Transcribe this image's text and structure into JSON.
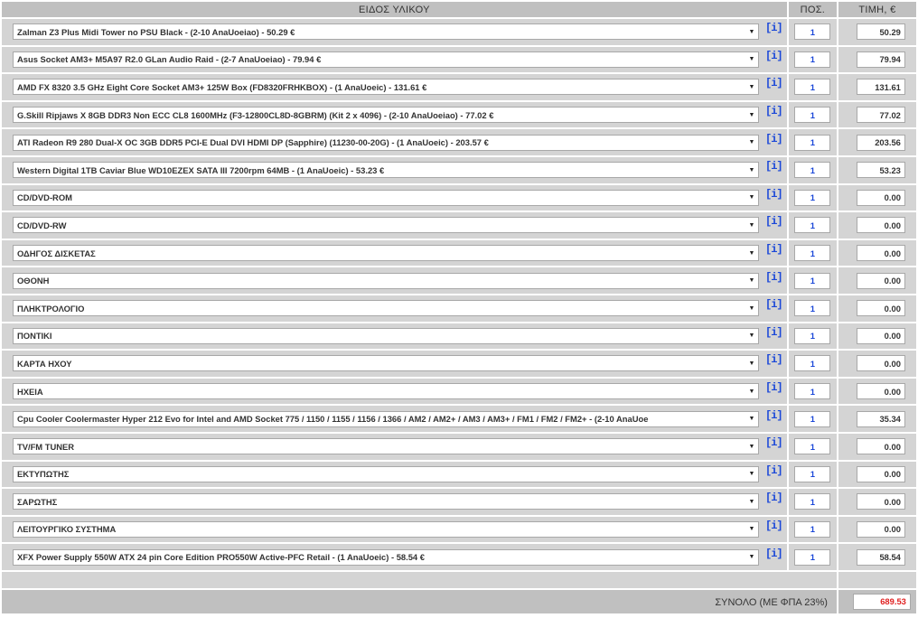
{
  "header": {
    "item_col": "ΕΙΔΟΣ ΥΛΙΚΟΥ",
    "qty_col": "ΠΟΣ.",
    "price_col": "ΤΙΜΗ, €"
  },
  "info_icon": "[i]",
  "dropdown_arrow": "▼",
  "rows": [
    {
      "item": "Zalman Z3 Plus Midi Tower no PSU Black - (2-10 AnaUoeiao) - 50.29 €",
      "qty": "1",
      "price": "50.29"
    },
    {
      "item": "Asus Socket AM3+ M5A97 R2.0 GLan Audio Raid - (2-7 AnaUoeiao) - 79.94 €",
      "qty": "1",
      "price": "79.94"
    },
    {
      "item": "AMD FX 8320 3.5 GHz Eight Core Socket AM3+ 125W Box (FD8320FRHKBOX) - (1 AnaUoeic) - 131.61 €",
      "qty": "1",
      "price": "131.61"
    },
    {
      "item": "G.Skill Ripjaws X 8GB DDR3 Non ECC CL8 1600MHz (F3-12800CL8D-8GBRM) (Kit 2 x 4096) - (2-10 AnaUoeiao) - 77.02 €",
      "qty": "1",
      "price": "77.02"
    },
    {
      "item": "ATI Radeon R9 280 Dual-X OC 3GB DDR5 PCI-E Dual DVI HDMI DP (Sapphire) (11230-00-20G) - (1 AnaUoeic) - 203.57 €",
      "qty": "1",
      "price": "203.56"
    },
    {
      "item": "Western Digital 1TB Caviar Blue WD10EZEX SATA III 7200rpm 64MB - (1 AnaUoeic) - 53.23 €",
      "qty": "1",
      "price": "53.23"
    },
    {
      "item": "CD/DVD-ROM",
      "qty": "1",
      "price": "0.00"
    },
    {
      "item": "CD/DVD-RW",
      "qty": "1",
      "price": "0.00"
    },
    {
      "item": "ΟΔΗΓΟΣ ΔΙΣΚΕΤΑΣ",
      "qty": "1",
      "price": "0.00"
    },
    {
      "item": "ΟΘΟΝΗ",
      "qty": "1",
      "price": "0.00"
    },
    {
      "item": "ΠΛΗΚΤΡΟΛΟΓΙΟ",
      "qty": "1",
      "price": "0.00"
    },
    {
      "item": "ΠΟΝΤΙΚΙ",
      "qty": "1",
      "price": "0.00"
    },
    {
      "item": "ΚΑΡΤΑ ΗΧΟΥ",
      "qty": "1",
      "price": "0.00"
    },
    {
      "item": "ΗΧΕΙΑ",
      "qty": "1",
      "price": "0.00"
    },
    {
      "item": "Cpu Cooler Coolermaster Hyper 212 Evo for Intel and AMD Socket 775 / 1150 / 1155 / 1156 / 1366 / AM2 / AM2+ / AM3 / AM3+ / FM1 / FM2 / FM2+ - (2-10 AnaUoe",
      "qty": "1",
      "price": "35.34"
    },
    {
      "item": "TV/FM TUNER",
      "qty": "1",
      "price": "0.00"
    },
    {
      "item": "ΕΚΤΥΠΩΤΗΣ",
      "qty": "1",
      "price": "0.00"
    },
    {
      "item": "ΣΑΡΩΤΗΣ",
      "qty": "1",
      "price": "0.00"
    },
    {
      "item": "ΛΕΙΤΟΥΡΓΙΚΟ ΣΥΣΤΗΜΑ",
      "qty": "1",
      "price": "0.00"
    },
    {
      "item": "XFX Power Supply 550W ATX 24 pin Core Edition PRO550W Active-PFC Retail - (1 AnaUoeic) - 58.54 €",
      "qty": "1",
      "price": "58.54"
    }
  ],
  "total": {
    "label": "ΣΥΝΟΛΟ (ΜΕ ΦΠΑ 23%)",
    "value": "689.53",
    "value_color": "#e02020"
  },
  "colors": {
    "header_bg": "#c0c0c0",
    "row_bg": "#d4d4d4",
    "qty_text": "#1a47d8",
    "info_icon": "#1a47d8"
  }
}
